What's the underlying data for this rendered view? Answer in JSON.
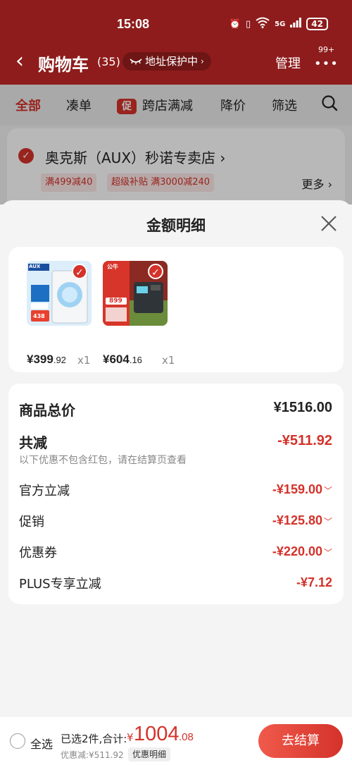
{
  "status_bar": {
    "time": "15:08",
    "network": "5G",
    "battery": "42"
  },
  "nav": {
    "title": "购物车",
    "count": "(35)",
    "address_protection": "地址保护中",
    "manage": "管理",
    "more_badge": "99+"
  },
  "tabs": [
    {
      "label": "全部"
    },
    {
      "label": "凑单"
    },
    {
      "badge": "促",
      "label": "跨店满减"
    },
    {
      "label": "降价"
    },
    {
      "label": "筛选"
    }
  ],
  "store": {
    "name": "奥克斯（AUX）秒诺专卖店",
    "tags": [
      "满499减40",
      "超级补贴  满3000减240"
    ],
    "more": "更多"
  },
  "sheet": {
    "title": "金额明细",
    "products": [
      {
        "price_int": "¥399",
        "price_dec": ".92",
        "qty": "x1",
        "thumb_text": "AUX",
        "thumb_price": "438"
      },
      {
        "price_int": "¥604",
        "price_dec": ".16",
        "qty": "x1",
        "thumb_text": "公牛",
        "thumb_price": "899"
      }
    ],
    "details": {
      "total_label": "商品总价",
      "total_value": "¥1516.00",
      "reduce_label": "共减",
      "reduce_value": "-¥511.92",
      "note": "以下优惠不包含红包，请在结算页查看",
      "items": [
        {
          "label": "官方立减",
          "value": "-¥159.00"
        },
        {
          "label": "促销",
          "value": "-¥125.80"
        },
        {
          "label": "优惠券",
          "value": "-¥220.00"
        },
        {
          "label": "PLUS专享立减",
          "value": "-¥7.12"
        }
      ]
    }
  },
  "bottom": {
    "select_all": "全选",
    "selected": "已选2件,合计:",
    "currency": "¥",
    "total_int": "1004",
    "total_dec": ".08",
    "discount": "优惠减:¥511.92",
    "detail_button": "优惠明细",
    "checkout": "去结算"
  },
  "colors": {
    "header": "#8e1c1c",
    "accent": "#d4322a"
  }
}
